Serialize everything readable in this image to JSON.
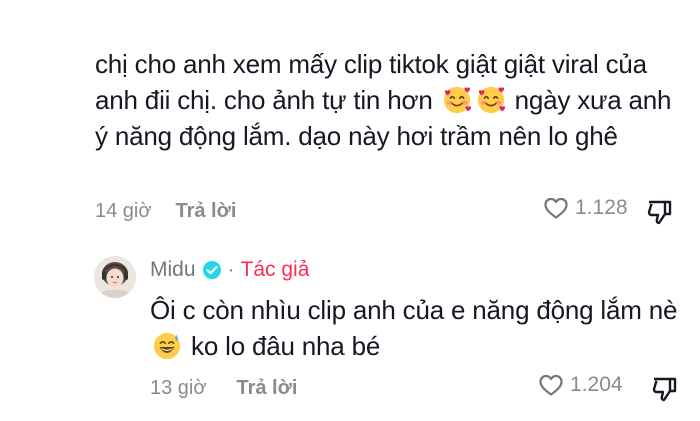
{
  "comment": {
    "text_part1": "chị cho anh xem mấy clip tiktok giật giật viral của anh đii chị. cho ảnh tự tin hơn",
    "text_part2": "ngày xưa anh ý năng động lắm. dạo này hơi trầm nên lo ghê",
    "emoji_icons": [
      "smiling-face-with-hearts-icon",
      "smiling-face-with-hearts-icon"
    ],
    "time": "14 giờ",
    "reply_label": "Trả lời",
    "likes": "1.128"
  },
  "reply": {
    "author": "Midu",
    "role": "Tác giả",
    "dot": "·",
    "text_part1": "Ôi c còn nhìu clip anh của e năng động lắm nè",
    "text_part2": "ko lo đâu nha bé",
    "emoji_icon": "grinning-face-with-sweat-icon",
    "time": "13 giờ",
    "reply_label": "Trả lời",
    "likes": "1.204"
  },
  "colors": {
    "text": "#161823",
    "muted": "#8a8b91",
    "author_role": "#fe2c55",
    "verified": "#20d5ec"
  }
}
